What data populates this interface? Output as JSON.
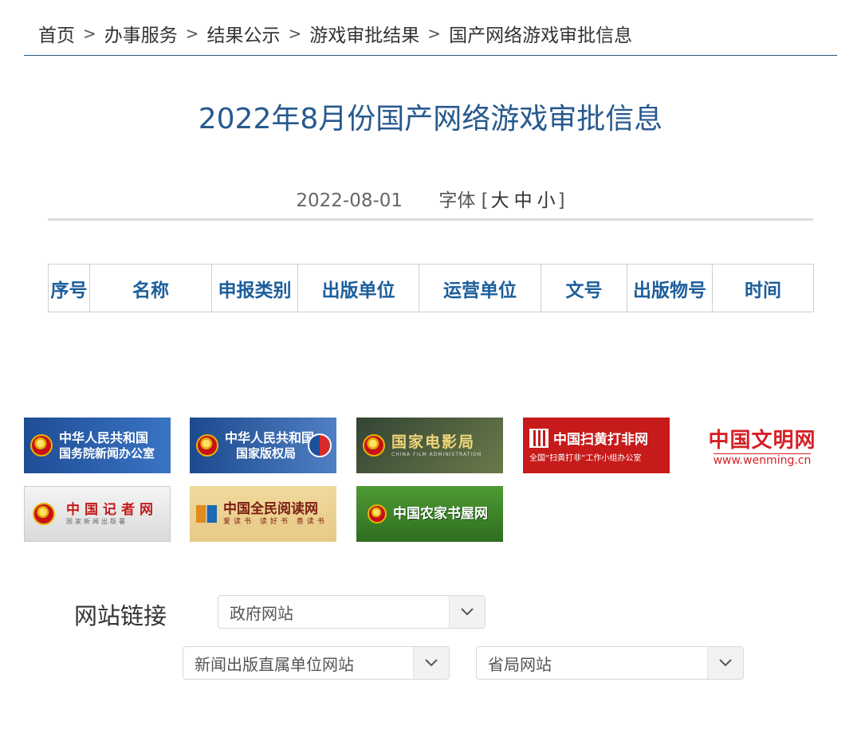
{
  "breadcrumb": [
    {
      "label": "首页"
    },
    {
      "label": "办事服务"
    },
    {
      "label": "结果公示"
    },
    {
      "label": "游戏审批结果"
    },
    {
      "label": "国产网络游戏审批信息"
    }
  ],
  "breadcrumb_separator": ">",
  "article": {
    "title": "2022年8月份国产网络游戏审批信息",
    "date": "2022-08-01",
    "font_size_label": "字体",
    "font_size_open": "[",
    "font_size_close": "]",
    "font_sizes": [
      "大",
      "中",
      "小"
    ]
  },
  "table": {
    "headers": [
      "序号",
      "名称",
      "申报类别",
      "出版单位",
      "运营单位",
      "文号",
      "出版物号",
      "时间"
    ]
  },
  "banners": {
    "scio": {
      "line1": "中华人民共和国",
      "line2": "国务院新闻办公室"
    },
    "ncac": {
      "line1": "中华人民共和国",
      "line2": "国家版权局"
    },
    "film": {
      "line1": "国家电影局",
      "small": "CHINA FILM ADMINISTRATION"
    },
    "sdxf": {
      "line1": "中国扫黄打非网",
      "small": "全国“扫黄打非”工作小组办公室"
    },
    "wenming": {
      "line1": "中国文明网",
      "line2": "www.wenming.cn"
    },
    "reporter": {
      "line1": "中国记者网",
      "small": "国家新闻出版署"
    },
    "reading": {
      "line1": "中国全民阅读网",
      "small": "爱读书 读好书 善读书",
      "tag": "全民阅读"
    },
    "farm": {
      "line1": "中国农家书屋网"
    }
  },
  "links": {
    "label": "网站链接",
    "selects": [
      {
        "value": "政府网站"
      },
      {
        "value": "新闻出版直属单位网站"
      },
      {
        "value": "省局网站"
      }
    ]
  },
  "colors": {
    "title": "#27598e",
    "table_header": "#1c5e9b",
    "breadcrumb_line": "#2d5476"
  }
}
